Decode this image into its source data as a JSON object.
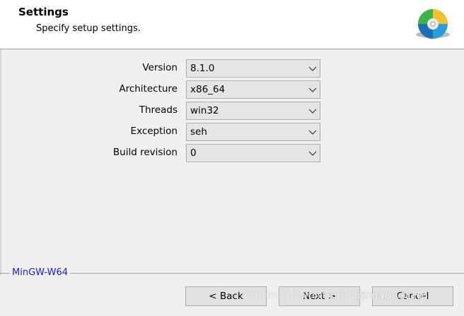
{
  "header": {
    "title": "Settings",
    "subtitle": "Specify setup settings.",
    "icon": "cd-disc-icon"
  },
  "settings": [
    {
      "label": "Version",
      "value": "8.1.0"
    },
    {
      "label": "Architecture",
      "value": "x86_64"
    },
    {
      "label": "Threads",
      "value": "win32"
    },
    {
      "label": "Exception",
      "value": "seh"
    },
    {
      "label": "Build revision",
      "value": "0"
    }
  ],
  "footer": {
    "brand": "MinGW-W64",
    "back_label": "< Back",
    "next_label": "Next >",
    "cancel_label": "Cancel"
  },
  "watermark": {
    "main": "知乎 @mahaoLHB",
    "url": "https://blog.csdn.net/u_programming_iu"
  },
  "colors": {
    "brand": "#1a1ad6",
    "background": "#f0f0f0",
    "combo_background": "#e5e5e5"
  }
}
